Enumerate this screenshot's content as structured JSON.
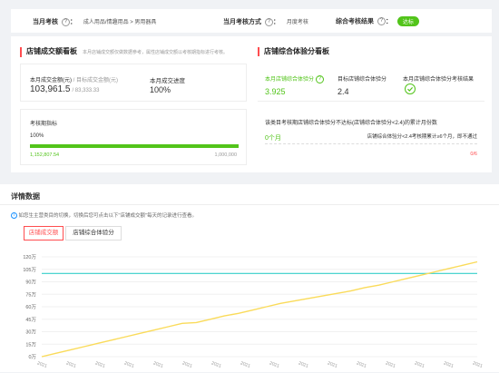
{
  "header": {
    "month_assess_label": "当月考核",
    "month_assess_value": "成人用品/情趣用品 > 男用器具",
    "method_label": "当月考核方式",
    "method_value": "月度考核",
    "result_label": "综合考核结果",
    "result_badge": "达标",
    "colon": "："
  },
  "left_panel": {
    "title": "店铺成交额看板",
    "subtitle": "本月店铺成交额仅做数据参考，属性店铺成交额以考核期指标进行考核。",
    "turnover_label": "本月成交金额(元)",
    "target_label": "/ 目标成交金额(元)",
    "turnover_value": "103,961.5",
    "target_value": "/ 83,333.33",
    "progress_label": "本月成交进度",
    "progress_value": "100%",
    "period_title": "考核期指标",
    "period_percent": "100%",
    "period_progress": 1.0,
    "period_current": "1,152,807.54",
    "period_target": "1,000,000"
  },
  "right_panel": {
    "title": "店铺综合体验分看板",
    "score_label": "本月店铺综合体验分",
    "score_value": "3.925",
    "target_label": "目标店铺综合体验分",
    "target_value": "2.4",
    "result_label": "本月店铺综合体验分考核结果",
    "months_title": "该类目考核期店铺综合体验分不达标(店铺综合体验分<2.4)的累计月份数",
    "months_value": "0个月",
    "months_note": "店铺综合体验分<2.4考核期累计≥6个月，即不通过",
    "months_fraction": "0/6"
  },
  "detail": {
    "title": "详情数据",
    "info": "如您生主营类目的切换，切换后您可点击以下\"店铺成交额\"每天的记录进行查看。",
    "tabs": [
      "店铺成交额",
      "店铺综合体验分"
    ]
  },
  "chart_data": {
    "type": "line",
    "y_ticks": [
      "120万",
      "105万",
      "90万",
      "75万",
      "60万",
      "45万",
      "30万",
      "15万",
      "0万"
    ],
    "ylim": [
      0,
      120
    ],
    "ylabel": "",
    "reference_line": 100,
    "x_tick_label": "2021",
    "series": [
      {
        "values": [
          0,
          4,
          8,
          12,
          16,
          20,
          24,
          28,
          32,
          36,
          40,
          41,
          45,
          49,
          52,
          56,
          60,
          64,
          67,
          70,
          73,
          76,
          79,
          83,
          86,
          90,
          94,
          98,
          102,
          106,
          110,
          114
        ]
      }
    ],
    "colors": {
      "line": "#fadb5a",
      "reference": "#36cfc9",
      "grid": "#f0f0f0"
    }
  }
}
